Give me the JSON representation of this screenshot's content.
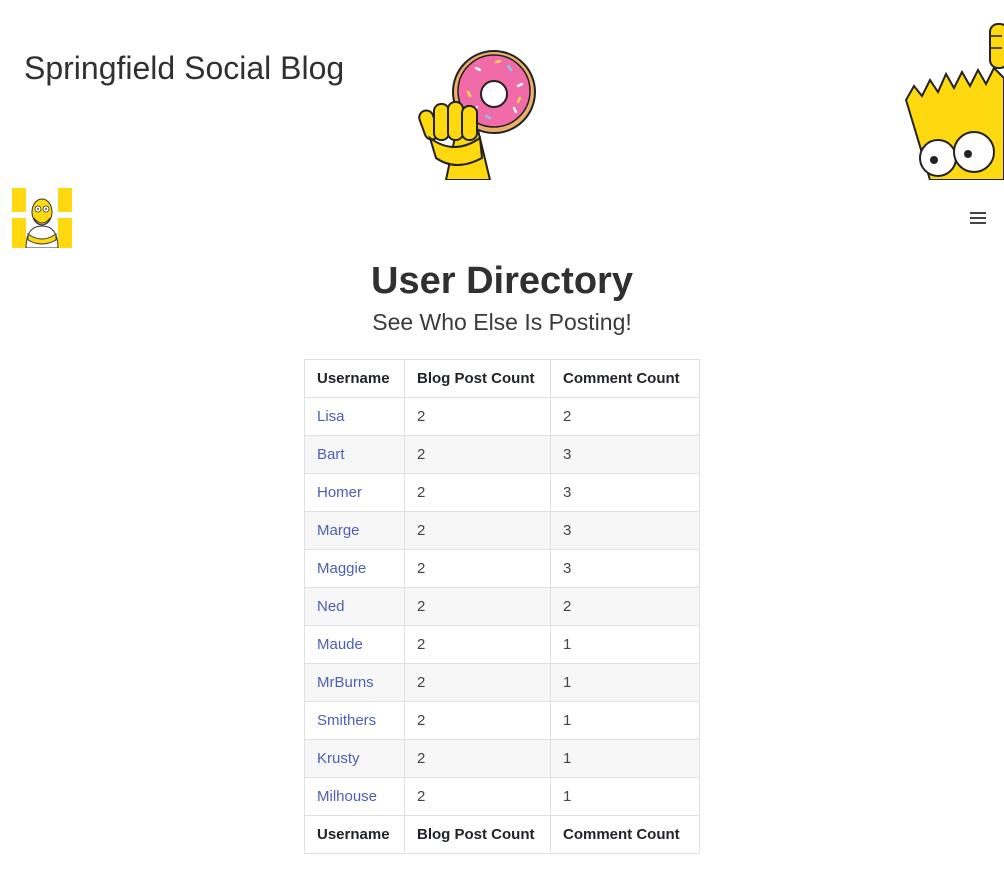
{
  "header": {
    "site_title": "Springfield Social Blog"
  },
  "nav": {
    "logo_icon": "homer-avatar-icon",
    "menu_icon": "hamburger-menu-icon"
  },
  "main": {
    "title": "User Directory",
    "subtitle": "See Who Else Is Posting!"
  },
  "table": {
    "columns": [
      "Username",
      "Blog Post Count",
      "Comment Count"
    ],
    "rows": [
      {
        "username": "Lisa",
        "posts": "2",
        "comments": "2"
      },
      {
        "username": "Bart",
        "posts": "2",
        "comments": "3"
      },
      {
        "username": "Homer",
        "posts": "2",
        "comments": "3"
      },
      {
        "username": "Marge",
        "posts": "2",
        "comments": "3"
      },
      {
        "username": "Maggie",
        "posts": "2",
        "comments": "3"
      },
      {
        "username": "Ned",
        "posts": "2",
        "comments": "2"
      },
      {
        "username": "Maude",
        "posts": "2",
        "comments": "1"
      },
      {
        "username": "MrBurns",
        "posts": "2",
        "comments": "1"
      },
      {
        "username": "Smithers",
        "posts": "2",
        "comments": "1"
      },
      {
        "username": "Krusty",
        "posts": "2",
        "comments": "1"
      },
      {
        "username": "Milhouse",
        "posts": "2",
        "comments": "1"
      }
    ]
  },
  "colors": {
    "link": "#4b5fb6",
    "simpsons_yellow": "#fed90f",
    "donut_frosting": "#f06ba8"
  }
}
